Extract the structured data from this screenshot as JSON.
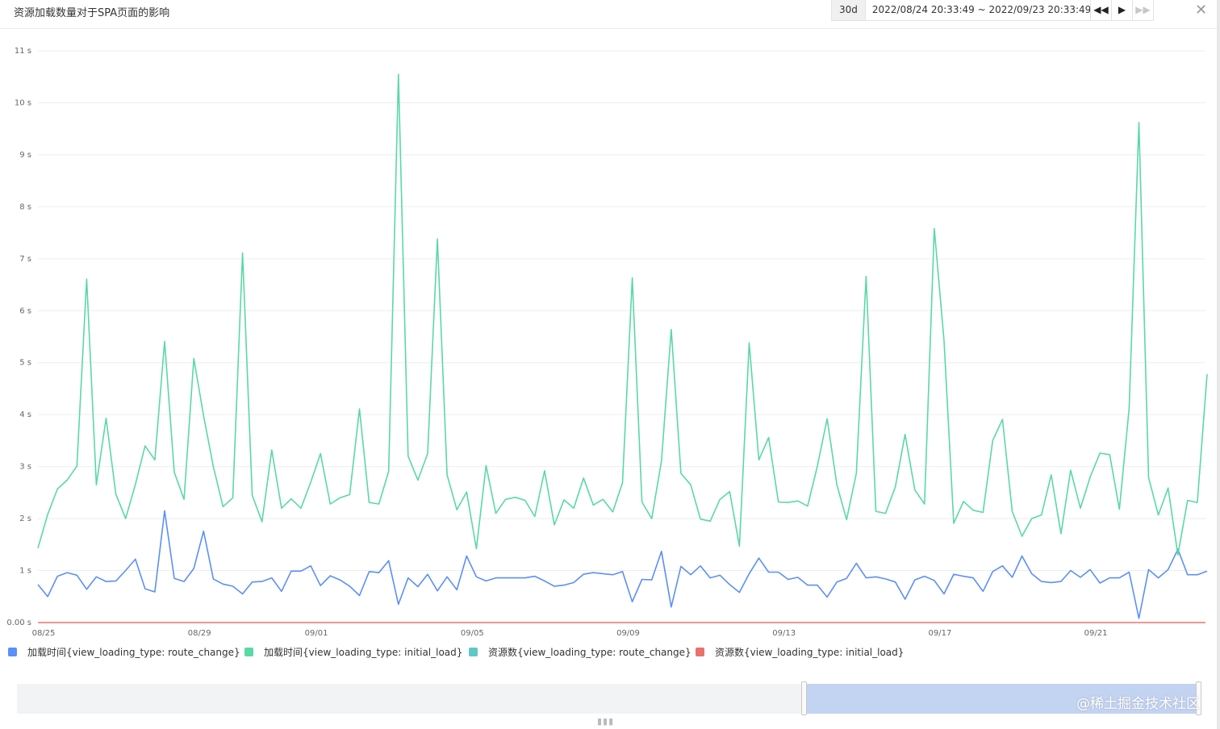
{
  "header": {
    "title": "资源加载数量对于SPA页面的影响",
    "range_button": "30d",
    "range_text": "2022/08/24 20:33:49 ~ 2022/09/23 20:33:49",
    "nav": [
      {
        "icon": "rewind-icon",
        "glyph": "◀◀"
      },
      {
        "icon": "play-icon",
        "glyph": "▶"
      },
      {
        "icon": "fast-forward-icon",
        "glyph": "▶▶"
      }
    ],
    "close_glyph": "✕"
  },
  "watermark": "@稀土掘金技术社区",
  "grip": "▮▮▮",
  "chart_data": {
    "type": "line",
    "title": "",
    "xlabel": "",
    "ylabel": "",
    "ylim": [
      0,
      11
    ],
    "yticks": [
      "0.00 s",
      "1 s",
      "2 s",
      "3 s",
      "4 s",
      "5 s",
      "6 s",
      "7 s",
      "8 s",
      "9 s",
      "10 s",
      "11 s"
    ],
    "xticks": [
      {
        "label": "08/25",
        "day": 0
      },
      {
        "label": "08/29",
        "day": 4
      },
      {
        "label": "09/01",
        "day": 7
      },
      {
        "label": "09/05",
        "day": 11
      },
      {
        "label": "09/09",
        "day": 15
      },
      {
        "label": "09/13",
        "day": 19
      },
      {
        "label": "09/17",
        "day": 23
      },
      {
        "label": "09/21",
        "day": 27
      }
    ],
    "x_interval": "6h",
    "grid": true,
    "legend_position": "bottom-left",
    "series": [
      {
        "name": "加载时间{view_loading_type: route_change}",
        "color": "#5b8ff9",
        "values": [
          0.73,
          0.5,
          0.89,
          0.96,
          0.91,
          0.64,
          0.88,
          0.79,
          0.8,
          1.0,
          1.22,
          0.65,
          0.59,
          2.15,
          0.85,
          0.79,
          1.04,
          1.76,
          0.84,
          0.74,
          0.7,
          0.55,
          0.78,
          0.79,
          0.86,
          0.6,
          0.99,
          0.99,
          1.09,
          0.71,
          0.9,
          0.82,
          0.7,
          0.52,
          0.98,
          0.96,
          1.19,
          0.35,
          0.86,
          0.69,
          0.93,
          0.61,
          0.88,
          0.63,
          1.28,
          0.88,
          0.8,
          0.86,
          0.86,
          0.86,
          0.86,
          0.89,
          0.8,
          0.7,
          0.72,
          0.77,
          0.93,
          0.96,
          0.94,
          0.92,
          0.98,
          0.4,
          0.83,
          0.82,
          1.37,
          0.3,
          1.08,
          0.92,
          1.09,
          0.86,
          0.91,
          0.73,
          0.58,
          0.94,
          1.24,
          0.97,
          0.97,
          0.83,
          0.87,
          0.72,
          0.72,
          0.49,
          0.78,
          0.85,
          1.14,
          0.86,
          0.88,
          0.84,
          0.78,
          0.45,
          0.82,
          0.89,
          0.81,
          0.55,
          0.93,
          0.89,
          0.86,
          0.6,
          0.98,
          1.09,
          0.87,
          1.28,
          0.94,
          0.79,
          0.77,
          0.79,
          1.0,
          0.87,
          1.02,
          0.76,
          0.86,
          0.86,
          0.97,
          0.08,
          1.02,
          0.86,
          1.02,
          1.41,
          0.92,
          0.92,
          0.99
        ]
      },
      {
        "name": "加载时间{view_loading_type: initial_load}",
        "color": "#5ad8a6",
        "values": [
          1.43,
          2.08,
          2.57,
          2.74,
          3.01,
          6.61,
          2.65,
          3.93,
          2.47,
          2.0,
          2.66,
          3.4,
          3.13,
          5.41,
          2.89,
          2.37,
          5.08,
          3.98,
          3.0,
          2.23,
          2.4,
          7.11,
          2.45,
          1.94,
          3.32,
          2.2,
          2.38,
          2.2,
          2.7,
          3.25,
          2.28,
          2.4,
          2.46,
          4.11,
          2.31,
          2.28,
          2.91,
          10.55,
          3.2,
          2.74,
          3.25,
          7.38,
          2.84,
          2.17,
          2.51,
          1.42,
          3.02,
          2.1,
          2.37,
          2.41,
          2.35,
          2.04,
          2.92,
          1.88,
          2.36,
          2.2,
          2.78,
          2.26,
          2.37,
          2.13,
          2.69,
          6.63,
          2.32,
          2.0,
          3.11,
          5.64,
          2.87,
          2.65,
          1.99,
          1.95,
          2.37,
          2.52,
          1.47,
          5.38,
          3.13,
          3.56,
          2.32,
          2.31,
          2.34,
          2.24,
          3.01,
          3.92,
          2.65,
          1.98,
          2.87,
          6.66,
          2.14,
          2.1,
          2.61,
          3.62,
          2.55,
          2.28,
          7.58,
          5.42,
          1.91,
          2.33,
          2.16,
          2.12,
          3.5,
          3.91,
          2.14,
          1.66,
          2.0,
          2.07,
          2.84,
          1.71,
          2.93,
          2.2,
          2.8,
          3.26,
          3.23,
          2.18,
          4.12,
          9.62,
          2.79,
          2.07,
          2.59,
          1.3,
          2.35,
          2.31,
          4.78
        ]
      },
      {
        "name": "资源数{view_loading_type: route_change}",
        "color": "#5dc8c8",
        "values": []
      },
      {
        "name": "资源数{view_loading_type: initial_load}",
        "color": "#e8736b",
        "values": [
          0,
          0
        ]
      }
    ]
  }
}
